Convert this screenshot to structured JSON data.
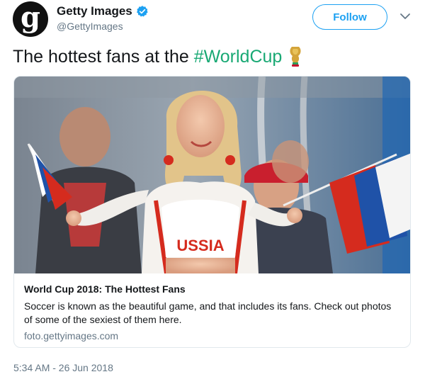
{
  "account": {
    "display_name": "Getty Images",
    "handle": "@GettyImages",
    "avatar_letter": "g",
    "verified_color": "#1da1f2"
  },
  "actions": {
    "follow_label": "Follow"
  },
  "tweet": {
    "text": "The hottest fans at the ",
    "hashtag": "#WorldCup",
    "timestamp": "5:34 AM - 26 Jun 2018"
  },
  "card": {
    "photo_banner": "USSIA",
    "title": "World Cup 2018: The Hottest Fans",
    "description": "Soccer is known as the beautiful game, and that includes its fans. Check out photos of some of the sexiest of them here.",
    "domain": "foto.gettyimages.com"
  },
  "colors": {
    "accent": "#1da1f2",
    "hashtag": "#19a974",
    "text": "#14171a",
    "secondary": "#657786"
  }
}
